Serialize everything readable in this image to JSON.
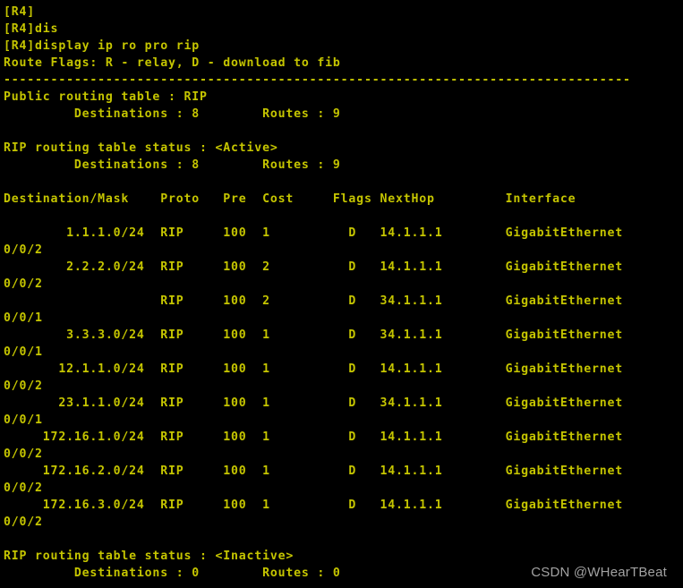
{
  "terminal": {
    "device_prompt": "[R4]",
    "colors": {
      "background": "#000000",
      "foreground": "#c5c500",
      "watermark": "#b9b9b9"
    },
    "lines": [
      "[R4]",
      "[R4]dis",
      "[R4]display ip ro pro rip",
      "Route Flags: R - relay, D - download to fib",
      "--------------------------------------------------------------------------------",
      "Public routing table : RIP",
      "         Destinations : 8        Routes : 9",
      "",
      "RIP routing table status : <Active>",
      "         Destinations : 8        Routes : 9",
      "",
      "Destination/Mask    Proto   Pre  Cost     Flags NextHop         Interface",
      "",
      "        1.1.1.0/24  RIP     100  1          D   14.1.1.1        GigabitEthernet",
      "0/0/2",
      "        2.2.2.0/24  RIP     100  2          D   14.1.1.1        GigabitEthernet",
      "0/0/2",
      "                    RIP     100  2          D   34.1.1.1        GigabitEthernet",
      "0/0/1",
      "        3.3.3.0/24  RIP     100  1          D   34.1.1.1        GigabitEthernet",
      "0/0/1",
      "       12.1.1.0/24  RIP     100  1          D   14.1.1.1        GigabitEthernet",
      "0/0/2",
      "       23.1.1.0/24  RIP     100  1          D   34.1.1.1        GigabitEthernet",
      "0/0/1",
      "     172.16.1.0/24  RIP     100  1          D   14.1.1.1        GigabitEthernet",
      "0/0/2",
      "     172.16.2.0/24  RIP     100  1          D   14.1.1.1        GigabitEthernet",
      "0/0/2",
      "     172.16.3.0/24  RIP     100  1          D   14.1.1.1        GigabitEthernet",
      "0/0/2",
      "",
      "RIP routing table status : <Inactive>",
      "         Destinations : 0        Routes : 0"
    ],
    "commands": [
      {
        "prompt": "[R4]",
        "text": ""
      },
      {
        "prompt": "[R4]",
        "text": "dis"
      },
      {
        "prompt": "[R4]",
        "text": "display ip ro pro rip"
      }
    ],
    "route_flags_legend": "Route Flags: R - relay, D - download to fib",
    "separator": "--------------------------------------------------------------------------------",
    "public_table": {
      "label": "Public routing table : RIP",
      "destinations_label": "Destinations :",
      "destinations_value": "8",
      "routes_label": "Routes :",
      "routes_value": "9"
    },
    "active_table": {
      "status_label": "RIP routing table status :",
      "status_value": "<Active>",
      "destinations_label": "Destinations :",
      "destinations_value": "8",
      "routes_label": "Routes :",
      "routes_value": "9"
    },
    "inactive_table": {
      "status_label": "RIP routing table status :",
      "status_value": "<Inactive>",
      "destinations_label": "Destinations :",
      "destinations_value": "0",
      "routes_label": "Routes :",
      "routes_value": "0"
    },
    "table": {
      "headers": [
        "Destination/Mask",
        "Proto",
        "Pre",
        "Cost",
        "Flags",
        "NextHop",
        "Interface"
      ],
      "rows": [
        {
          "destination": "1.1.1.0/24",
          "proto": "RIP",
          "pre": "100",
          "cost": "1",
          "flags": "D",
          "nexthop": "14.1.1.1",
          "interface": "GigabitEthernet",
          "interface_cont": "0/0/2"
        },
        {
          "destination": "2.2.2.0/24",
          "proto": "RIP",
          "pre": "100",
          "cost": "2",
          "flags": "D",
          "nexthop": "14.1.1.1",
          "interface": "GigabitEthernet",
          "interface_cont": "0/0/2"
        },
        {
          "destination": "",
          "proto": "RIP",
          "pre": "100",
          "cost": "2",
          "flags": "D",
          "nexthop": "34.1.1.1",
          "interface": "GigabitEthernet",
          "interface_cont": "0/0/1"
        },
        {
          "destination": "3.3.3.0/24",
          "proto": "RIP",
          "pre": "100",
          "cost": "1",
          "flags": "D",
          "nexthop": "34.1.1.1",
          "interface": "GigabitEthernet",
          "interface_cont": "0/0/1"
        },
        {
          "destination": "12.1.1.0/24",
          "proto": "RIP",
          "pre": "100",
          "cost": "1",
          "flags": "D",
          "nexthop": "14.1.1.1",
          "interface": "GigabitEthernet",
          "interface_cont": "0/0/2"
        },
        {
          "destination": "23.1.1.0/24",
          "proto": "RIP",
          "pre": "100",
          "cost": "1",
          "flags": "D",
          "nexthop": "34.1.1.1",
          "interface": "GigabitEthernet",
          "interface_cont": "0/0/1"
        },
        {
          "destination": "172.16.1.0/24",
          "proto": "RIP",
          "pre": "100",
          "cost": "1",
          "flags": "D",
          "nexthop": "14.1.1.1",
          "interface": "GigabitEthernet",
          "interface_cont": "0/0/2"
        },
        {
          "destination": "172.16.2.0/24",
          "proto": "RIP",
          "pre": "100",
          "cost": "1",
          "flags": "D",
          "nexthop": "14.1.1.1",
          "interface": "GigabitEthernet",
          "interface_cont": "0/0/2"
        },
        {
          "destination": "172.16.3.0/24",
          "proto": "RIP",
          "pre": "100",
          "cost": "1",
          "flags": "D",
          "nexthop": "14.1.1.1",
          "interface": "GigabitEthernet",
          "interface_cont": "0/0/2"
        }
      ]
    },
    "watermark": "CSDN @WHearTBeat"
  }
}
